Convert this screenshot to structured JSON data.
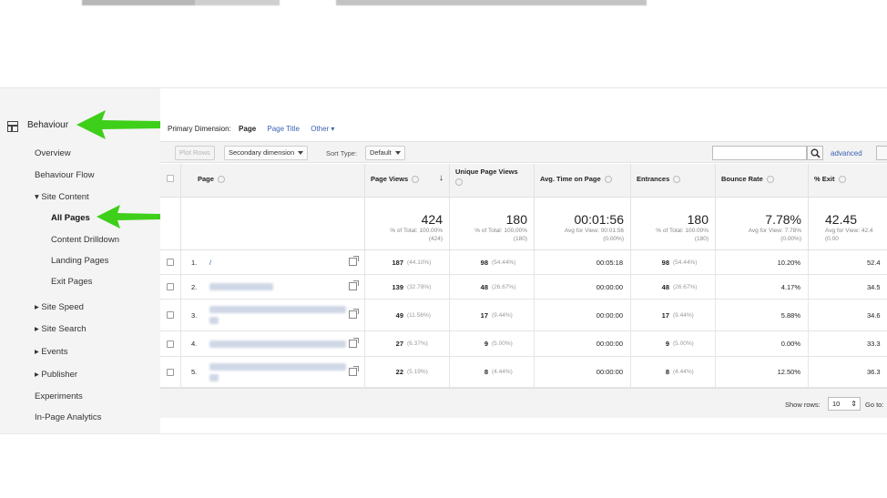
{
  "sidebar": {
    "section": "Behaviour",
    "items": [
      {
        "label": "Overview",
        "level": 1
      },
      {
        "label": "Behaviour Flow",
        "level": 1
      },
      {
        "label": "▾ Site Content",
        "level": 1
      },
      {
        "label": "All Pages",
        "level": 2,
        "active": true
      },
      {
        "label": "Content Drilldown",
        "level": 2
      },
      {
        "label": "Landing Pages",
        "level": 2
      },
      {
        "label": "Exit Pages",
        "level": 2
      },
      {
        "label": "▸ Site Speed",
        "level": 1
      },
      {
        "label": "▸ Site Search",
        "level": 1
      },
      {
        "label": "▸ Events",
        "level": 1
      },
      {
        "label": "▸ Publisher",
        "level": 1
      },
      {
        "label": "Experiments",
        "level": 1
      },
      {
        "label": "In-Page Analytics",
        "level": 1
      }
    ]
  },
  "dimension": {
    "label": "Primary Dimension:",
    "current": "Page",
    "options": [
      "Page Title",
      "Other ▾"
    ]
  },
  "toolbar": {
    "plot_rows": "Plot Rows",
    "secondary_dimension": "Secondary dimension",
    "sort_type_label": "Sort Type:",
    "sort_type_value": "Default",
    "search_value": "",
    "advanced": "advanced"
  },
  "table": {
    "columns": [
      "Page",
      "Page Views",
      "Unique Page Views",
      "Avg. Time on Page",
      "Entrances",
      "Bounce Rate",
      "% Exit"
    ],
    "totals": [
      {
        "big": "424",
        "sub1": "% of Total: 100.00%",
        "sub2": "(424)"
      },
      {
        "big": "180",
        "sub1": "% of Total: 100.00%",
        "sub2": "(180)"
      },
      {
        "big": "00:01:56",
        "sub1": "Avg for View: 00:01:56",
        "sub2": "(0.00%)"
      },
      {
        "big": "180",
        "sub1": "% of Total: 100.00%",
        "sub2": "(180)"
      },
      {
        "big": "7.78%",
        "sub1": "Avg for View: 7.78%",
        "sub2": "(0.00%)"
      },
      {
        "big": "42.45",
        "sub1": "Avg for View: 42.4",
        "sub2": "(0.00"
      }
    ],
    "rows": [
      {
        "idx": "1.",
        "page": "/",
        "pv": "187",
        "pv_pct": "(44.10%)",
        "upv": "98",
        "upv_pct": "(54.44%)",
        "time": "00:05:18",
        "ent": "98",
        "ent_pct": "(54.44%)",
        "bounce": "10.20%",
        "exit": "52.4"
      },
      {
        "idx": "2.",
        "page": "",
        "pv": "139",
        "pv_pct": "(32.78%)",
        "upv": "48",
        "upv_pct": "(26.67%)",
        "time": "00:00:00",
        "ent": "48",
        "ent_pct": "(26.67%)",
        "bounce": "4.17%",
        "exit": "34.5"
      },
      {
        "idx": "3.",
        "page": "",
        "pv": "49",
        "pv_pct": "(11.56%)",
        "upv": "17",
        "upv_pct": "(9.44%)",
        "time": "00:00:00",
        "ent": "17",
        "ent_pct": "(9.44%)",
        "bounce": "5.88%",
        "exit": "34.6"
      },
      {
        "idx": "4.",
        "page": "",
        "pv": "27",
        "pv_pct": "(6.37%)",
        "upv": "9",
        "upv_pct": "(5.00%)",
        "time": "00:00:00",
        "ent": "9",
        "ent_pct": "(5.00%)",
        "bounce": "0.00%",
        "exit": "33.3"
      },
      {
        "idx": "5.",
        "page": "",
        "pv": "22",
        "pv_pct": "(5.19%)",
        "upv": "8",
        "upv_pct": "(4.44%)",
        "time": "00:00:00",
        "ent": "8",
        "ent_pct": "(4.44%)",
        "bounce": "12.50%",
        "exit": "36.3"
      }
    ]
  },
  "footer": {
    "show_rows_label": "Show rows:",
    "show_rows_value": "10",
    "goto_label": "Go to:"
  },
  "colors": {
    "arrow": "#3ecf1a",
    "link": "#3a63b3",
    "header_bg": "#f3f3f3"
  }
}
